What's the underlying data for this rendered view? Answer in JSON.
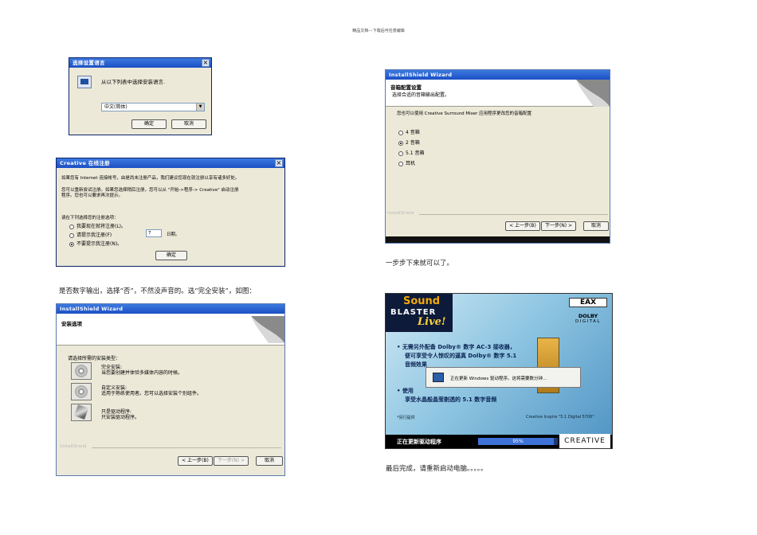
{
  "header": "精品文档---下载后可任意编辑",
  "lang_dialog": {
    "title": "选择设置语言",
    "prompt": "从以下列表中选择安装语言.",
    "selected": "中文(简体)",
    "ok": "确定",
    "cancel": "取消"
  },
  "reg_dialog": {
    "title": "Creative 在线注册",
    "para1": "如果您有 Internet 连接帐号，由是尚未注册产品，我们建议您现在就注册以享有诸多好处。",
    "para2a": "您可以重新尝试注册。如果您选择稍后注册，您可以从 \"开始->程序-> Creative\" 启动注册",
    "para2b": "程序。您也可以要求再次提示。",
    "prompt": "请在下列选择您的注册选项：",
    "options": [
      "我要现在就将注册(L)。",
      "请提示我注册(F)",
      "不要提示我注册(N)。"
    ],
    "days_value": "7",
    "days_label": "日期。",
    "ok": "确定"
  },
  "caption_digital": "是否数字输出，选择“否”，不然没声音的。选“完全安装”，如图：",
  "setup_wizard": {
    "title": "InstallShield Wizard",
    "heading": "安装选项",
    "prompt": "请选择所需的安装类型：",
    "options": [
      {
        "title": "完全安装:",
        "desc": "当您要创建并体验多媒体内容的时候。"
      },
      {
        "title": "自定义安装:",
        "desc": "适用于熟练使用者。您可以选择安装个别组件。"
      },
      {
        "title": "只是驱动程序:",
        "desc": "只安装驱动程序。"
      }
    ],
    "brand": "InstallShield",
    "back": "< 上一步(B)",
    "next": "下一步(N) >",
    "cancel": "取消"
  },
  "speaker_wizard": {
    "title": "InstallShield Wizard",
    "heading": "音箱配置设置",
    "sub": "选择合适的音箱输出配置。",
    "prompt": "您也可以使用 Creative Surround Mixer 应用程序更改您的音箱配置",
    "options": [
      "4 音箱",
      "2 音箱",
      "5.1 音箱",
      "耳机"
    ],
    "selected_index": 1,
    "brand": "InstallShield",
    "back": "< 上一步(B)",
    "next": "下一步(N) >",
    "cancel": "取消"
  },
  "caption_step": "一步步下来就可以了。",
  "splash": {
    "logo1": "Sound",
    "logo2": "BLASTER",
    "logo3": "Live!",
    "eax": "EAX",
    "dolby1": "DOLBY",
    "dolby2": "DIGITAL",
    "bullet1a": "无需另外配备 Dolby® 数字 AC-3 接收器，",
    "bullet1b": "便可享受令人惊叹的逼真 Dolby® 数字 5.1",
    "bullet1c": "音频效果",
    "bullet2a": "使用",
    "bullet2b": "享受水晶般晶莹剔透的 5.1 数字音频",
    "popup": "正在更新 Windows 驱动程序。这将需要数分钟...",
    "note": "*另行提供",
    "product": "Creative Inspire \"5.1 Digital 5700\"",
    "status": "正在更新驱动程序",
    "progress_label": "95%",
    "progress": 0.95,
    "brand": "CREATIVE"
  },
  "caption_done": "最后完成，请重新启动电脑。。。。。"
}
